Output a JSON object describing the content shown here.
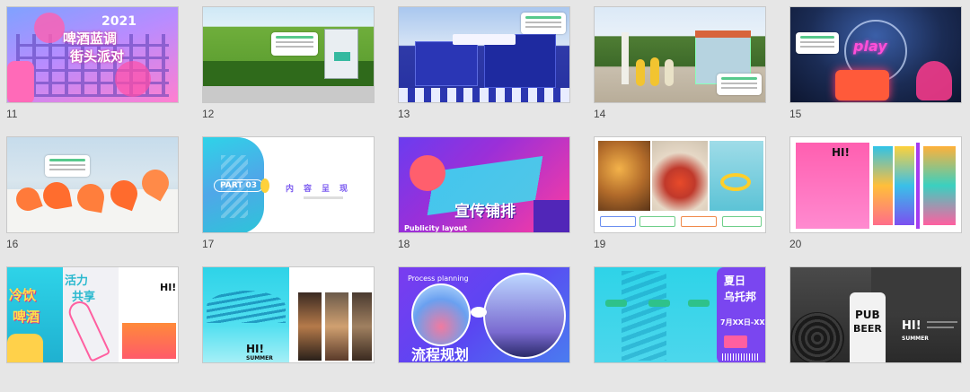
{
  "slides": [
    {
      "num": "11",
      "texts": [
        "2021",
        "啤酒蓝调",
        "街头派对"
      ]
    },
    {
      "num": "12",
      "texts": []
    },
    {
      "num": "13",
      "texts": []
    },
    {
      "num": "14",
      "texts": []
    },
    {
      "num": "15",
      "texts": [
        "play"
      ]
    },
    {
      "num": "16",
      "texts": []
    },
    {
      "num": "17",
      "texts": [
        "PART 03",
        "内",
        "容",
        "呈",
        "现"
      ]
    },
    {
      "num": "18",
      "texts": [
        "宣传铺排",
        "Publicity layout"
      ]
    },
    {
      "num": "19",
      "texts": []
    },
    {
      "num": "20",
      "texts": [
        "HI!"
      ]
    },
    {
      "num": "21",
      "texts": [
        "冷饮",
        "啤酒",
        "活力",
        "共享",
        "HI!"
      ]
    },
    {
      "num": "22",
      "texts": [
        "HI!",
        "SUMMER"
      ]
    },
    {
      "num": "23",
      "texts": [
        "Process planning",
        "流程规划"
      ]
    },
    {
      "num": "24",
      "texts": [
        "夏日",
        "乌托邦",
        "7月XX日-XX日"
      ]
    },
    {
      "num": "25",
      "texts": [
        "PUB",
        "BEER",
        "HI!",
        "SUMMER"
      ]
    }
  ],
  "colors": {
    "background": "#e6e6e6",
    "note_accent": "#57c98c",
    "purple": "#6b3cf0",
    "cyan": "#2ed3e8",
    "pink": "#ff3ca0"
  }
}
